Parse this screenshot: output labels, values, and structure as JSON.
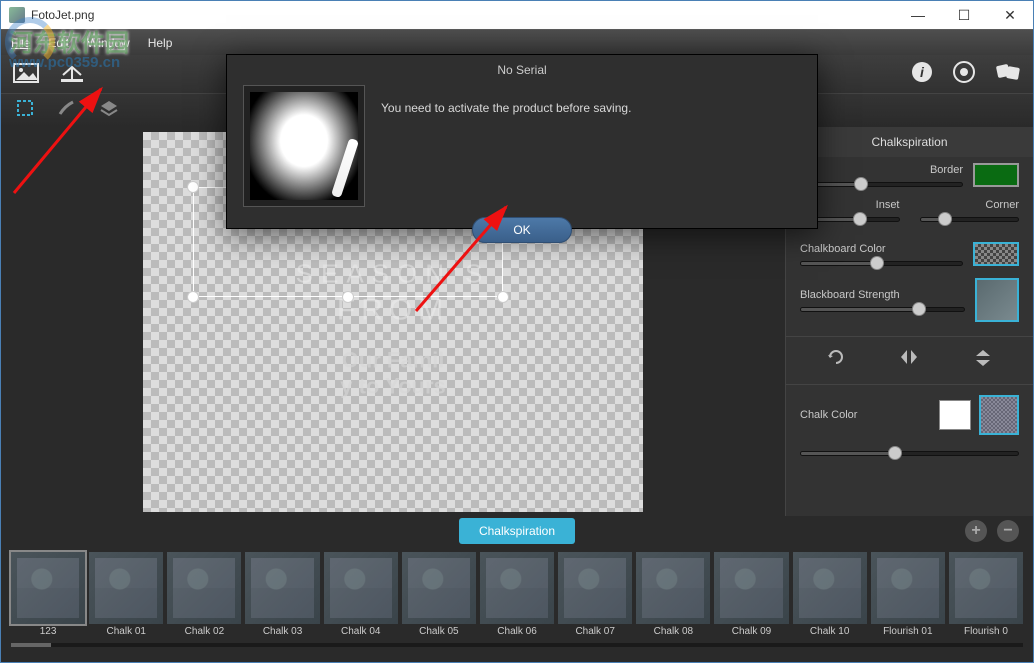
{
  "window": {
    "title": "FotoJet.png"
  },
  "watermark": {
    "text": "河东软件园",
    "url": "www.pc0359.cn"
  },
  "menu": {
    "file": "File",
    "edit": "Edit",
    "window": "Window",
    "help": "Help"
  },
  "modal": {
    "title": "No Serial",
    "message": "You need to activate the product before saving.",
    "ok": "OK"
  },
  "panel": {
    "title": "Chalkspiration",
    "border": "Border",
    "inset": "Inset",
    "corner": "Corner",
    "chalkboard_color": "Chalkboard Color",
    "blackboard_strength": "Blackboard Strength",
    "chalk_color": "Chalk Color",
    "colors": {
      "chalkboard": "#0a6b12",
      "chalk": "#ffffff"
    }
  },
  "canvas_overlay": {
    "line1": "SEASON'S",
    "line2": "FROM",
    "line3": "Our Famil",
    "line4": "y to Yours"
  },
  "preset": {
    "tab": "Chalkspiration",
    "items": [
      "123",
      "Chalk 01",
      "Chalk 02",
      "Chalk 03",
      "Chalk 04",
      "Chalk 05",
      "Chalk 06",
      "Chalk 07",
      "Chalk 08",
      "Chalk 09",
      "Chalk 10",
      "Flourish 01",
      "Flourish 0"
    ]
  }
}
